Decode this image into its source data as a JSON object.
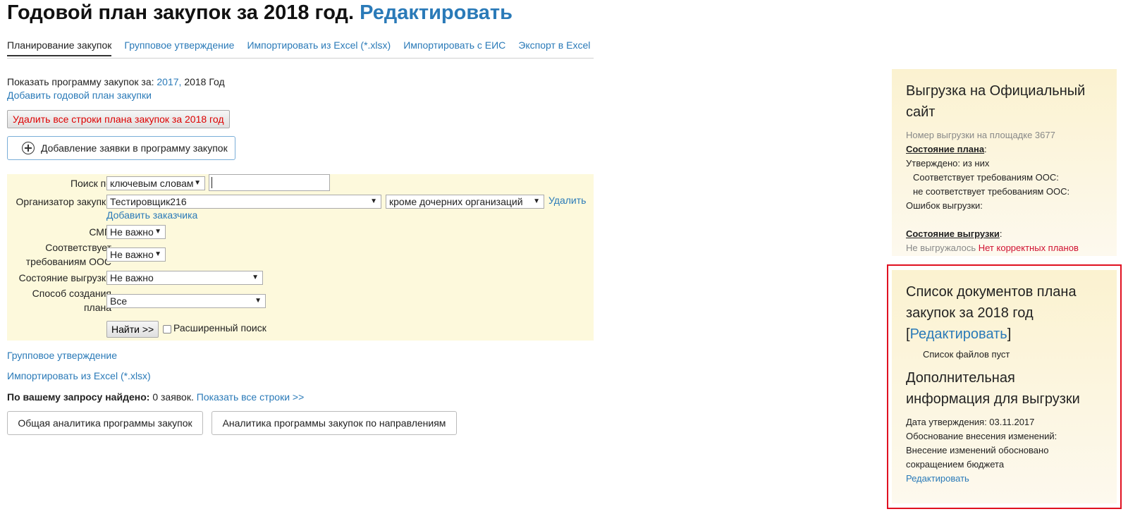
{
  "header": {
    "title": "Годовой план закупок за 2018 год.",
    "edit_link": "Редактировать"
  },
  "tabs": [
    {
      "label": "Планирование закупок",
      "active": true
    },
    {
      "label": "Групповое утверждение"
    },
    {
      "label": "Импортировать из Excel (*.xlsx)"
    },
    {
      "label": "Импортировать с ЕИС"
    },
    {
      "label": "Экспорт в Excel"
    }
  ],
  "program": {
    "show_label": "Показать программу закупок за:",
    "year_link": "2017,",
    "year_current": "2018 Год",
    "add_plan_link": "Добавить годовой план закупки",
    "delete_button": "Удалить все строки плана закупок за 2018 год",
    "add_request_button": "Добавление заявки в программу закупок"
  },
  "filter": {
    "search_label": "Поиск по",
    "search_mode": "ключевым словам",
    "search_value": "",
    "organizer_label": "Организатор закупки",
    "organizer_value": "Тестировщик216",
    "subsidiaries_value": "кроме дочерних организаций",
    "delete_link": "Удалить",
    "add_customer_link": "Добавить заказчика",
    "smp_label": "СМП",
    "smp_value": "Не важно",
    "oos_label_1": "Соответствует",
    "oos_label_2": "требованиям ООС",
    "oos_value": "Не важно",
    "upload_state_label": "Состояние выгрузки",
    "upload_state_value": "Не важно",
    "creation_label_1": "Способ создания",
    "creation_label_2": "плана",
    "creation_value": "Все",
    "find_button": "Найти >>",
    "extended_search_label": "Расширенный поиск"
  },
  "links": {
    "group_approval": "Групповое утверждение",
    "import_excel": "Импортировать из Excel (*.xlsx)"
  },
  "results": {
    "found_label": "По вашему запросу найдено:",
    "found_count": "0 заявок.",
    "show_all_link": "Показать все строки >>"
  },
  "analytics": {
    "general_button": "Общая аналитика программы закупок",
    "directions_button": "Аналитика программы закупок по направлениям"
  },
  "upload_panel": {
    "title": "Выгрузка на Официальный сайт",
    "upload_number": "Номер выгрузки на площадке 3677",
    "plan_state_label": "Состояние плана",
    "approved": "Утверждено: из них",
    "oos_compliant": "Соответствует требованиям ООС:",
    "oos_noncompliant": "не соответствует требованиям ООС:",
    "upload_errors": "Ошибок выгрузки:",
    "upload_state_label": "Состояние выгрузки",
    "not_uploaded": "Не выгружалось",
    "no_valid_plans": "Нет корректных планов"
  },
  "docs_panel": {
    "title": "Список документов плана закупок за 2018 год",
    "bracket_open": "[",
    "edit_link": "Редактировать",
    "bracket_close": "]",
    "files_empty": "Список файлов пуст",
    "extra_title": "Дополнительная информация для выгрузки",
    "approval_date": "Дата утверждения: 03.11.2017",
    "change_reason_label": "Обоснование внесения изменений:",
    "change_reason_1": "Внесение изменений обосновано",
    "change_reason_2": "сокращением бюджета",
    "edit_link_2": "Редактировать"
  },
  "colors": {
    "link": "#2a7ab8",
    "filter_bg": "#fdf9dc",
    "alert": "#d01030",
    "highlight_border": "#e01020"
  }
}
